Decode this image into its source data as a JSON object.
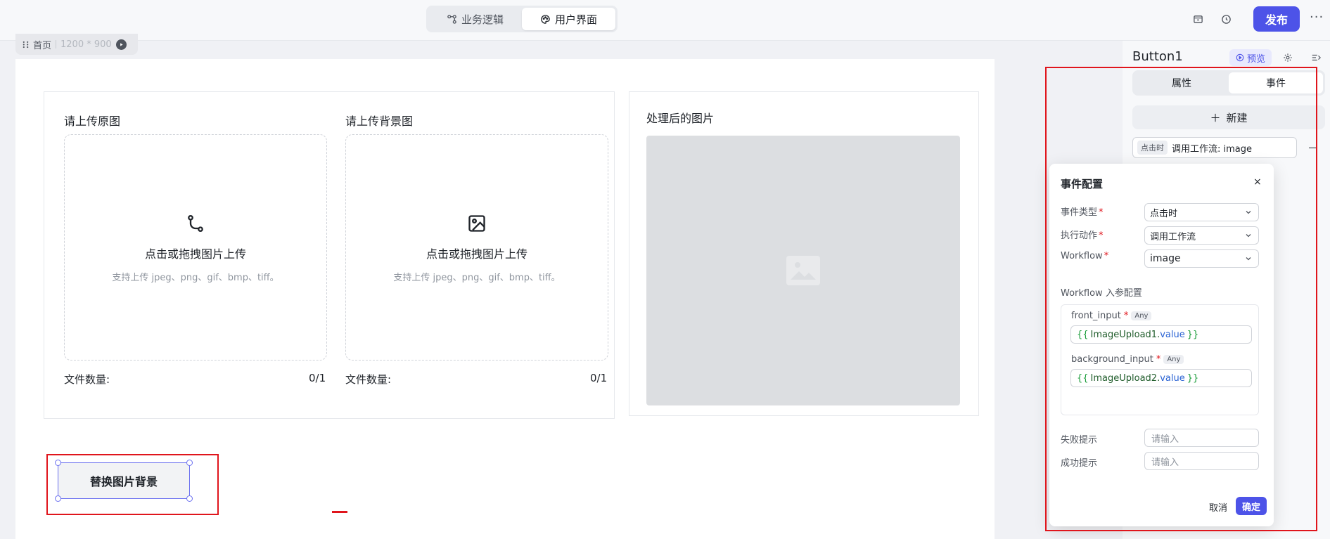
{
  "header": {
    "tabs": [
      {
        "label": "业务逻辑",
        "icon": "workflow-icon",
        "active": false
      },
      {
        "label": "用户界面",
        "icon": "palette-icon",
        "active": true
      }
    ],
    "publish_label": "发布",
    "icons": [
      "archive-icon",
      "history-icon",
      "more-icon"
    ],
    "more_label": "···"
  },
  "page_chip": {
    "page_name": "首页",
    "size": "1200 * 900"
  },
  "canvas": {
    "upload1": {
      "title": "请上传原图",
      "main_text": "点击或拖拽图片上传",
      "hint": "支持上传 jpeg、png、gif、bmp、tiff。",
      "count_label": "文件数量:",
      "count_value": "0/1"
    },
    "upload2": {
      "title": "请上传背景图",
      "main_text": "点击或拖拽图片上传",
      "hint": "支持上传 jpeg、png、gif、bmp、tiff。",
      "count_label": "文件数量:",
      "count_value": "0/1"
    },
    "processed_title": "处理后的图片",
    "button_label": "替换图片背景"
  },
  "right_panel": {
    "component_name": "Button1",
    "preview_label": "预览",
    "tabs": [
      {
        "label": "属性",
        "active": false
      },
      {
        "label": "事件",
        "active": true
      }
    ],
    "new_label": "新建",
    "event_item": {
      "tag": "点击时",
      "text": "调用工作流: image"
    }
  },
  "dialog": {
    "title": "事件配置",
    "close": "×",
    "event_type_label": "事件类型",
    "event_type_value": "点击时",
    "action_label": "执行动作",
    "action_value": "调用工作流",
    "workflow_label": "Workflow",
    "workflow_value": "image",
    "params_label": "Workflow 入参配置",
    "params": [
      {
        "name": "front_input",
        "type": "Any",
        "open": "{{",
        "ref": "ImageUpload1.",
        "prop": "value",
        "close": "}}"
      },
      {
        "name": "background_input",
        "type": "Any",
        "open": "{{",
        "ref": "ImageUpload2.",
        "prop": "value",
        "close": "}}"
      }
    ],
    "fail_label": "失败提示",
    "fail_placeholder": "请输入",
    "success_label": "成功提示",
    "success_placeholder": "请输入",
    "cancel_label": "取消",
    "ok_label": "确定"
  },
  "colors": {
    "accent": "#4d53e8",
    "highlight": "#e0151c"
  }
}
